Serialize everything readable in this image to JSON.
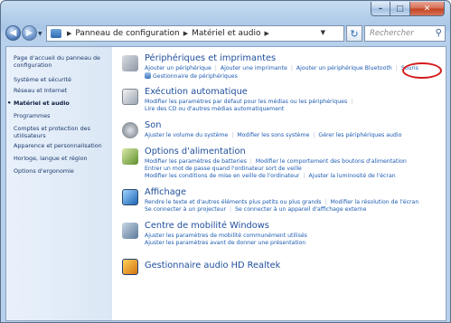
{
  "window": {
    "buttons": {
      "minimize": "–",
      "maximize": "□",
      "close": "✕"
    }
  },
  "toolbar": {
    "back_icon": "◀",
    "forward_icon": "▶",
    "address": [
      "Panneau de configuration",
      "Matériel et audio"
    ],
    "refresh_icon": "↻",
    "search_placeholder": "Rechercher",
    "search_icon": "⚲"
  },
  "sidebar": {
    "items": [
      {
        "label": "Page d'accueil du panneau de configuration"
      },
      {
        "label": "Système et sécurité"
      },
      {
        "label": "Réseau et Internet"
      },
      {
        "label": "Matériel et audio",
        "current": true
      },
      {
        "label": "Programmes"
      },
      {
        "label": "Comptes et protection des utilisateurs"
      },
      {
        "label": "Apparence et personnalisation"
      },
      {
        "label": "Horloge, langue et région"
      },
      {
        "label": "Options d'ergonomie"
      }
    ]
  },
  "categories": [
    {
      "title": "Périphériques et imprimantes",
      "icon": "printer-icon",
      "links": [
        [
          "Ajouter un périphérique",
          "Ajouter une imprimante",
          "Ajouter un périphérique Bluetooth",
          "Souris"
        ],
        [
          "Gestionnaire de périphériques"
        ]
      ]
    },
    {
      "title": "Exécution automatique",
      "icon": "autoplay-icon",
      "links": [
        [
          "Modifier les paramètres par défaut pour les médias ou les périphériques"
        ],
        [
          "Lire des CD ou d'autres médias automatiquement"
        ]
      ]
    },
    {
      "title": "Son",
      "icon": "speaker-icon",
      "links": [
        [
          "Ajuster le volume du système",
          "Modifier les sons système",
          "Gérer les périphériques audio"
        ]
      ]
    },
    {
      "title": "Options d'alimentation",
      "icon": "power-icon",
      "links": [
        [
          "Modifier les paramètres de batteries",
          "Modifier le comportement des boutons d'alimentation"
        ],
        [
          "Entrer un mot de passe quand l'ordinateur sort de veille"
        ],
        [
          "Modifier les conditions de mise en veille de l'ordinateur",
          "Ajuster la luminosité de l'écran"
        ]
      ]
    },
    {
      "title": "Affichage",
      "icon": "display-icon",
      "links": [
        [
          "Rendre le texte et d'autres éléments plus petits ou plus grands",
          "Modifier la résolution de l'écran"
        ],
        [
          "Se connecter à un projecteur",
          "Se connecter à un appareil d'affichage externe"
        ]
      ]
    },
    {
      "title": "Centre de mobilité Windows",
      "icon": "mobility-icon",
      "links": [
        [
          "Ajuster les paramètres de mobilité communément utilisés"
        ],
        [
          "Ajuster les paramètres avant de donner une présentation"
        ]
      ]
    },
    {
      "title": "Gestionnaire audio HD Realtek",
      "icon": "realtek-audio-icon",
      "links": []
    }
  ],
  "highlight": {
    "target": "Souris",
    "color": "#d41c1c"
  },
  "colors": {
    "link": "#1d5bb1",
    "title": "#1f4e9c",
    "sidebar_bg": "#dbe7f5"
  }
}
